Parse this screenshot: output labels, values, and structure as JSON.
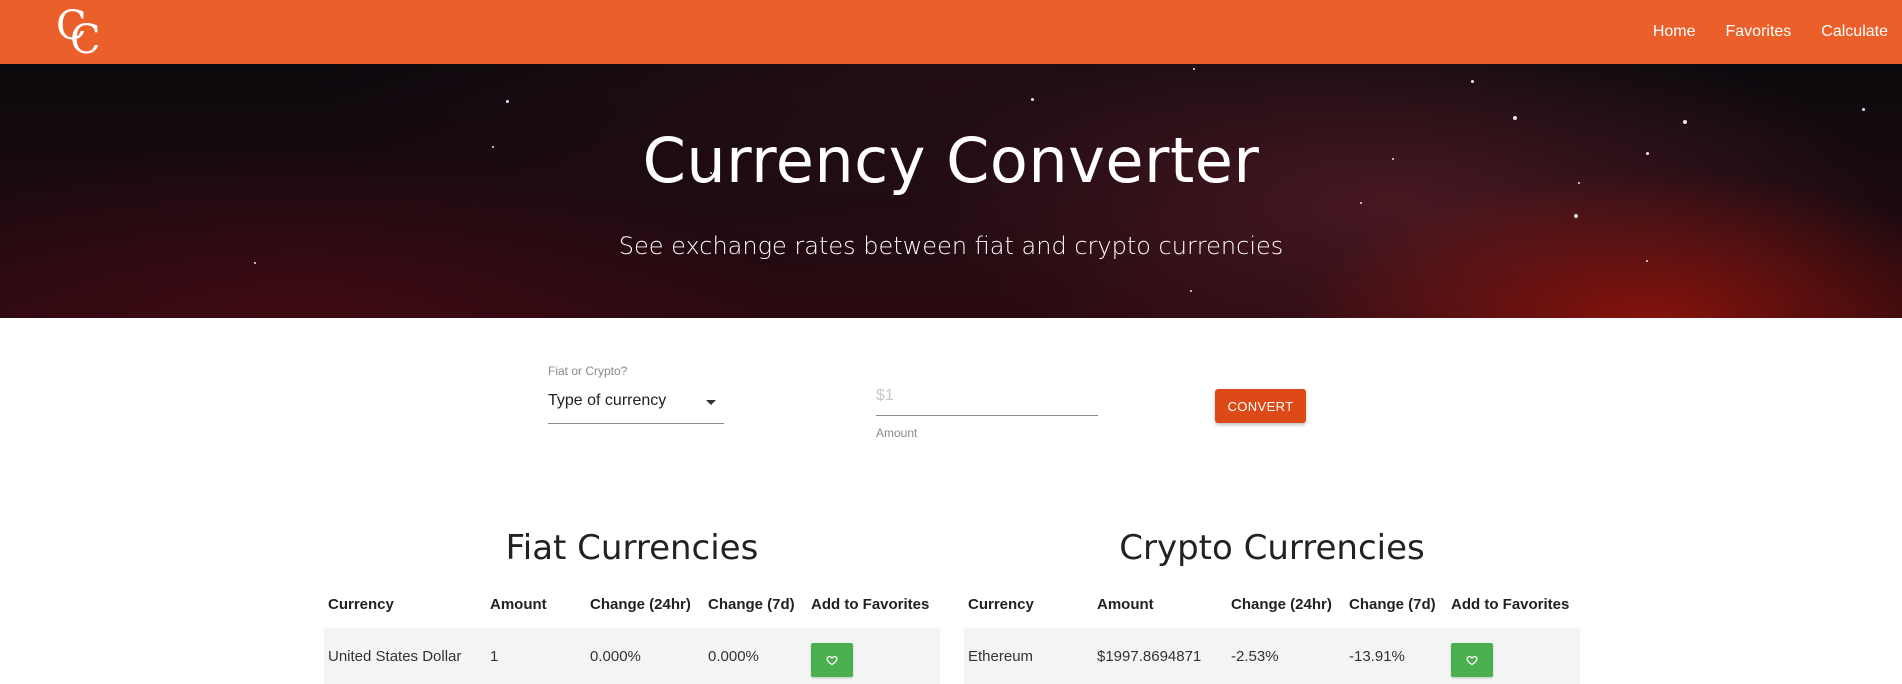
{
  "nav": {
    "logo_letter_1": "C",
    "logo_letter_2": "C",
    "links": [
      "Home",
      "Favorites",
      "Calculate"
    ]
  },
  "hero": {
    "title": "Currency Converter",
    "subtitle": "See exchange rates between fiat and crypto currencies"
  },
  "converter": {
    "type_label": "Fiat or Crypto?",
    "type_value": "Type of currency",
    "amount_placeholder": "$1",
    "amount_helper": "Amount",
    "convert_label": "CONVERT"
  },
  "fiat": {
    "title": "Fiat Currencies",
    "headers": [
      "Currency",
      "Amount",
      "Change (24hr)",
      "Change (7d)",
      "Add to Favorites"
    ],
    "rows": [
      {
        "currency": "United States Dollar",
        "amount": "1",
        "change_24h": "0.000%",
        "change_7d": "0.000%"
      }
    ]
  },
  "crypto": {
    "title": "Crypto Currencies",
    "headers": [
      "Currency",
      "Amount",
      "Change (24hr)",
      "Change (7d)",
      "Add to Favorites"
    ],
    "rows": [
      {
        "currency": "Ethereum",
        "amount": "$1997.8694871",
        "change_24h": "-2.53%",
        "change_7d": "-13.91%"
      }
    ]
  },
  "colors": {
    "navbar": "#ea5f2a",
    "convert_button": "#de4a17",
    "favorite_button": "#4caf50"
  },
  "icons": {
    "favorite": "heart-icon",
    "dropdown": "caret-down-icon"
  }
}
